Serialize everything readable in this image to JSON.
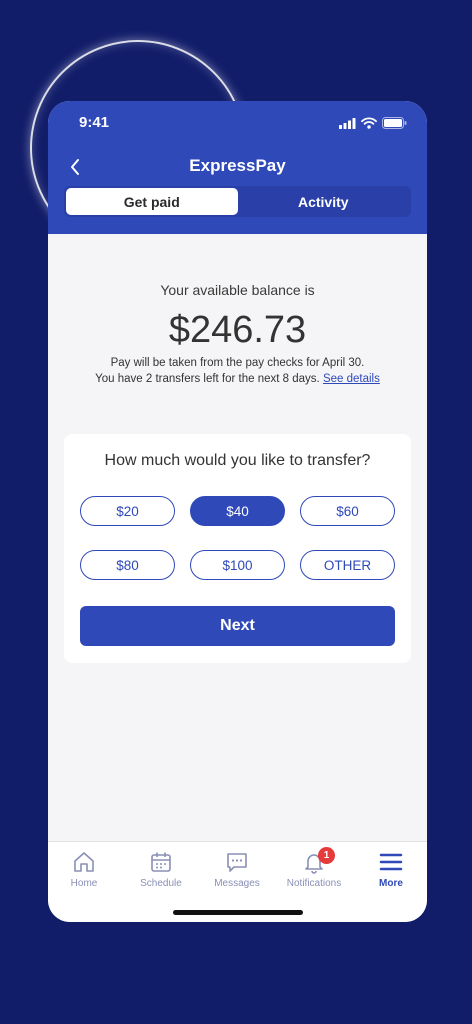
{
  "status_bar": {
    "time": "9:41"
  },
  "header": {
    "title": "ExpressPay"
  },
  "tabs": [
    {
      "label": "Get paid",
      "active": true
    },
    {
      "label": "Activity",
      "active": false
    }
  ],
  "balance": {
    "label": "Your available balance is",
    "amount": "$246.73",
    "note_line1": "Pay will be taken from the pay checks for April 30.",
    "note_line2": "You have 2 transfers left for the next 8 days.",
    "details_link": "See details"
  },
  "transfer": {
    "question": "How much would you like to transfer?",
    "options": [
      "$20",
      "$40",
      "$60",
      "$80",
      "$100",
      "OTHER"
    ],
    "selected": "$40",
    "next_label": "Next"
  },
  "tabbar": {
    "items": [
      {
        "label": "Home",
        "icon": "home-icon"
      },
      {
        "label": "Schedule",
        "icon": "calendar-icon"
      },
      {
        "label": "Messages",
        "icon": "chat-icon"
      },
      {
        "label": "Notifications",
        "icon": "bell-icon",
        "badge": "1"
      },
      {
        "label": "More",
        "icon": "menu-icon",
        "active": true
      }
    ]
  },
  "colors": {
    "brand": "#2f49b9",
    "background": "#121d6a",
    "badge": "#e53b3b"
  }
}
